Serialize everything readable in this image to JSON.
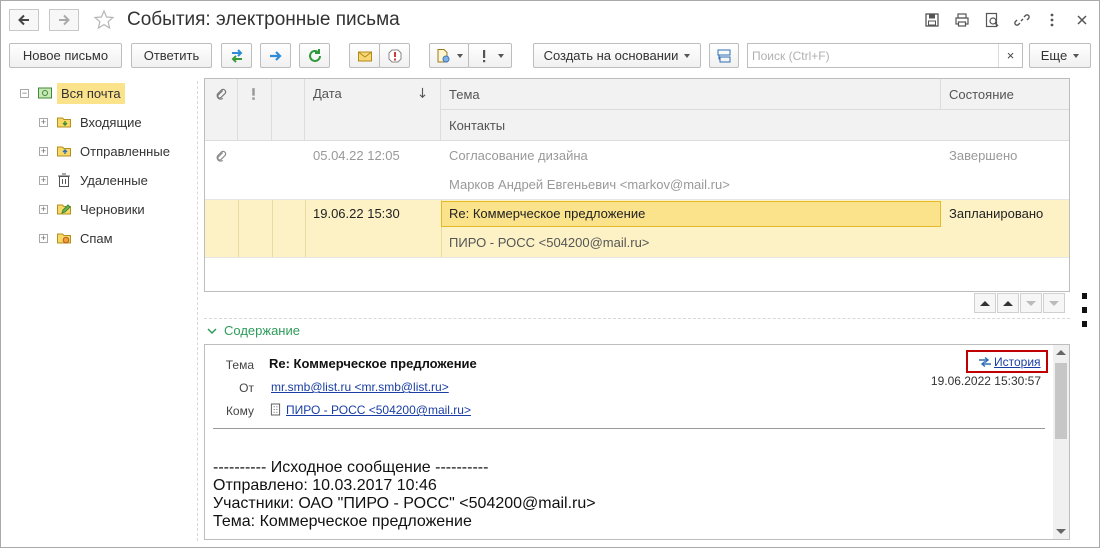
{
  "window": {
    "title": "События: электронные письма"
  },
  "toolbar": {
    "new_letter": "Новое письмо",
    "reply": "Ответить",
    "create_based": "Создать на основании",
    "more": "Еще",
    "search_placeholder": "Поиск (Ctrl+F)",
    "search_clear": "×"
  },
  "tree": {
    "root": "Вся почта",
    "items": [
      "Входящие",
      "Отправленные",
      "Удаленные",
      "Черновики",
      "Спам"
    ]
  },
  "grid": {
    "headers": {
      "date": "Дата",
      "subject": "Тема",
      "status": "Состояние",
      "contacts": "Контакты"
    },
    "rows": [
      {
        "date": "05.04.22 12:05",
        "subject": "Согласование дизайна",
        "status": "Завершено",
        "contact": "Марков Андрей Евгеньевич <markov@mail.ru>"
      },
      {
        "date": "19.06.22 15:30",
        "subject": "Re: Коммерческое предложение",
        "status": "Запланировано",
        "contact": "ПИРО - РОСС <504200@mail.ru>"
      }
    ]
  },
  "preview": {
    "section_title": "Содержание",
    "subject_label": "Тема",
    "subject": "Re: Коммерческое предложение",
    "from_label": "От",
    "from": "mr.smb@list.ru <mr.smb@list.ru>",
    "to_label": "Кому",
    "to": "ПИРО - РОСС <504200@mail.ru>",
    "history": "История",
    "date": "19.06.2022 15:30:57",
    "body": [
      "---------- Исходное сообщение ----------",
      "Отправлено: 10.03.2017 10:46",
      "Участники: ОАО \"ПИРО - РОСС\" <504200@mail.ru>",
      "Тема: Коммерческое предложение"
    ]
  },
  "colors": {
    "selection": "#fbe38c",
    "accent_green": "#2e9c5a",
    "link": "#1a3ea3",
    "highlight_border": "#c00000"
  }
}
